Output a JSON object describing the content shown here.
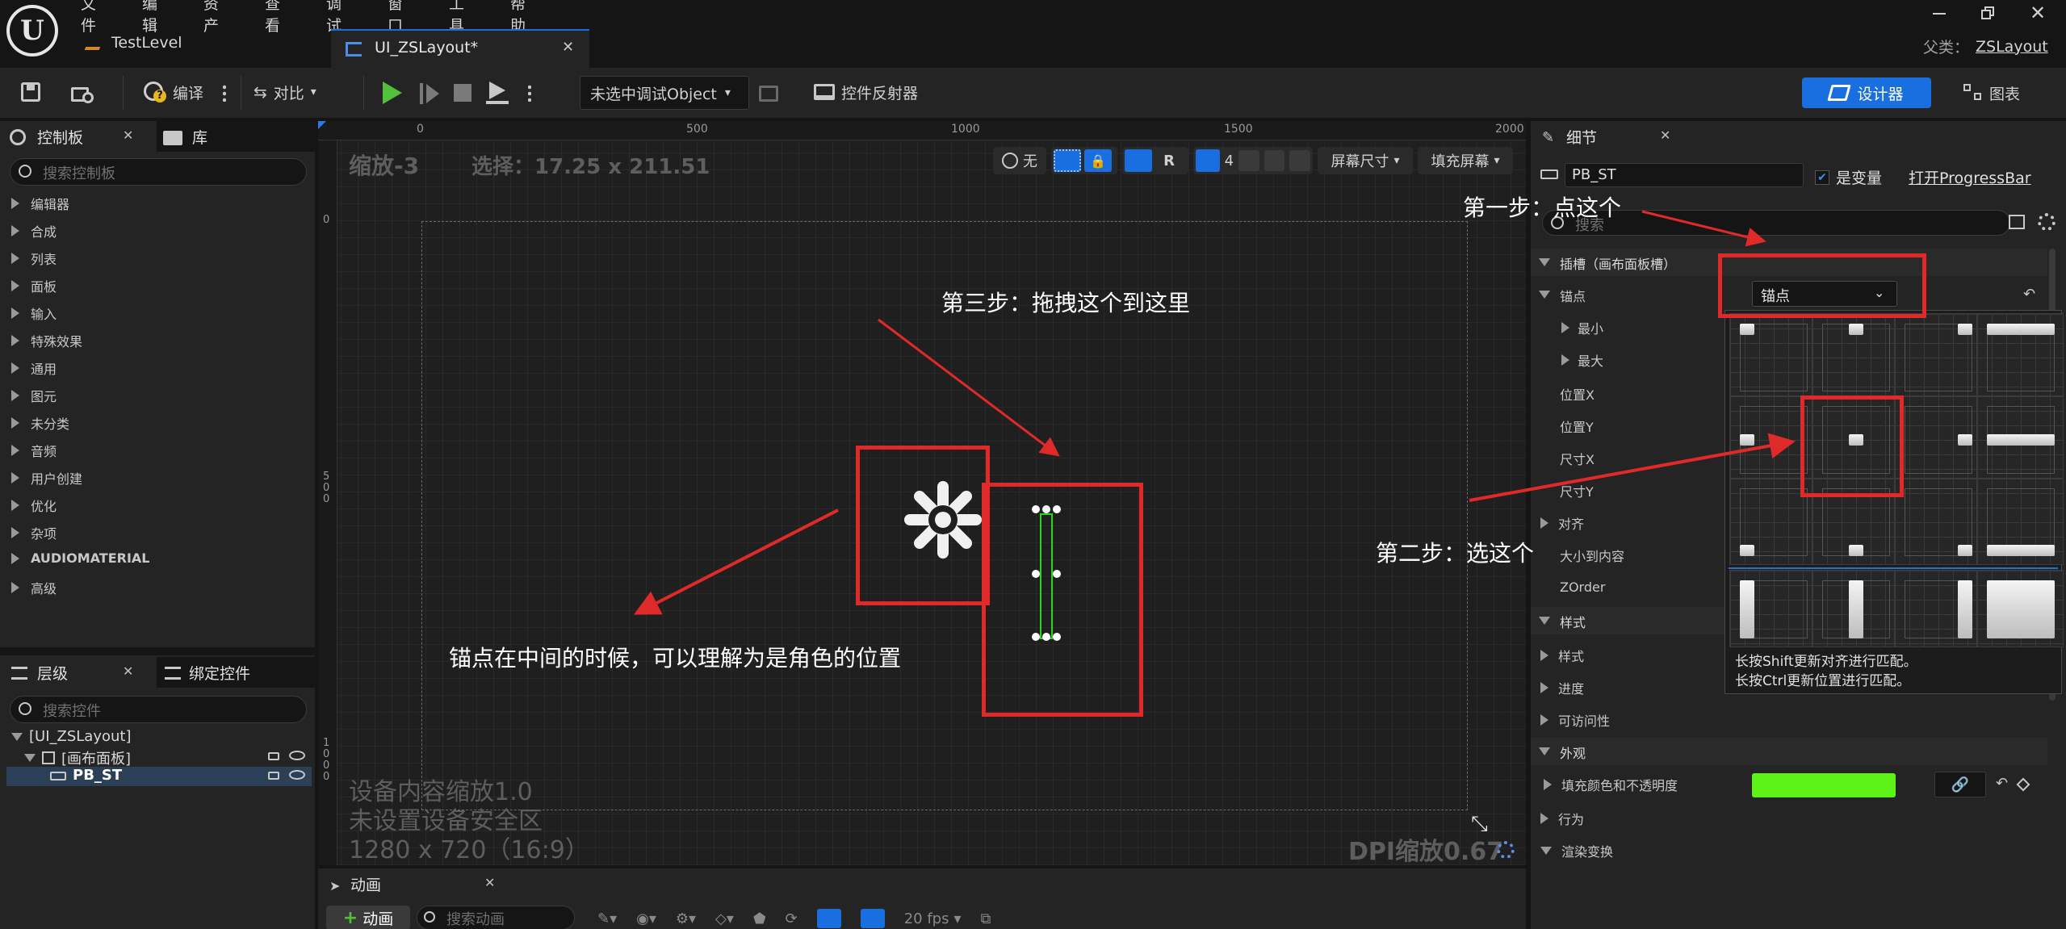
{
  "menu": [
    "文件",
    "编辑",
    "资产",
    "查看",
    "调试",
    "窗口",
    "工具",
    "帮助"
  ],
  "tabs": {
    "level": "TestLevel",
    "widget": "UI_ZSLayout*"
  },
  "parent": {
    "label": "父类：",
    "value": "ZSLayout"
  },
  "toolbar": {
    "compile": "编译",
    "diff": "对比",
    "debug_object": "未选中调试Object",
    "widget_reflector": "控件反射器",
    "designer": "设计器",
    "graph": "图表"
  },
  "palette": {
    "title": "控制板",
    "library": "库",
    "search_placeholder": "搜索控制板",
    "categories": [
      "编辑器",
      "合成",
      "列表",
      "面板",
      "输入",
      "特殊效果",
      "通用",
      "图元",
      "未分类",
      "音频",
      "用户创建",
      "优化",
      "杂项",
      "AUDIOMATERIAL",
      "高级"
    ]
  },
  "hierarchy": {
    "title": "层级",
    "bind_tab": "绑定控件",
    "search_placeholder": "搜索控件",
    "items": [
      "[UI_ZSLayout]",
      "[画布面板]",
      "PB_ST"
    ]
  },
  "canvas": {
    "zoom": "缩放-3",
    "selection": "选择：17.25 x 211.51",
    "ruler_marks": [
      "0",
      "500",
      "1000",
      "1500",
      "2000"
    ],
    "vruler_marks": [
      "0",
      "5\n0\n0",
      "1\n0\n0\n0"
    ],
    "none_label": "无",
    "r_label": "R",
    "grid_snap": "4",
    "screen_size": "屏幕尺寸",
    "fill_screen": "填充屏幕",
    "device_scale": "设备内容缩放1.0",
    "safe_zone": "未设置设备安全区",
    "resolution": "1280 x 720（16:9）",
    "dpi_scale": "DPI缩放0.67"
  },
  "animation": {
    "title": "动画",
    "add_button": "动画",
    "search_placeholder": "搜索动画",
    "fps": "20 fps"
  },
  "details": {
    "title": "细节",
    "widget_name": "PB_ST",
    "is_variable": "是变量",
    "open_link": "打开ProgressBar",
    "search_placeholder": "搜索",
    "slot_section": "插槽（画布面板槽）",
    "anchor_label": "锚点",
    "anchor_value": "锚点",
    "min": "最小",
    "max": "最大",
    "pos_x": "位置X",
    "pos_y": "位置Y",
    "size_x": "尺寸X",
    "size_y": "尺寸Y",
    "alignment": "对齐",
    "size_to_content": "大小到内容",
    "zorder": "ZOrder",
    "style_section": "样式",
    "style": "样式",
    "progress": "进度",
    "accessibility": "可访问性",
    "appearance_section": "外观",
    "fill_color": "填充颜色和不透明度",
    "fill_color_value": "#5df218",
    "behavior": "行为",
    "render_transform": "渲染变换"
  },
  "anchor_popup": {
    "hint1": "长按Shift更新对齐进行匹配。",
    "hint2": "长按Ctrl更新位置进行匹配。"
  },
  "annotations": {
    "step1": "第一步：点这个",
    "step2": "第二步：选这个",
    "step3": "第三步：拖拽这个到这里",
    "note": "锚点在中间的时候，可以理解为是角色的位置"
  },
  "colors": {
    "accent_blue": "#1a6fe0",
    "annotation_red": "#e02a2a",
    "selection_green": "#2bd51b"
  }
}
